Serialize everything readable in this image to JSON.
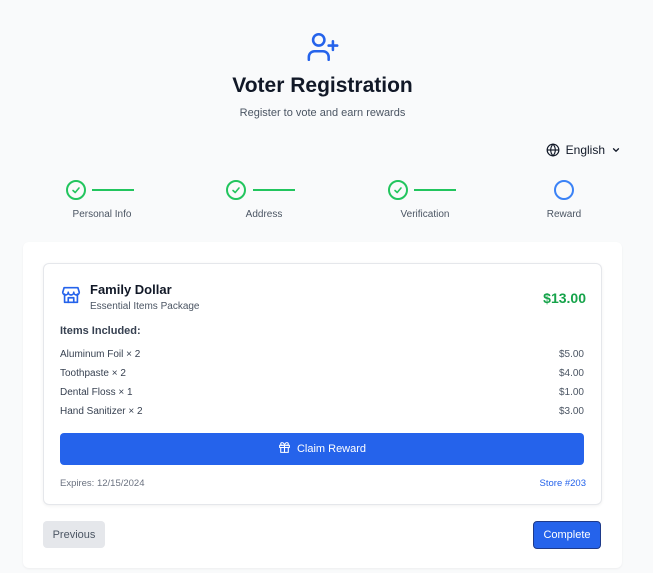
{
  "header": {
    "title": "Voter Registration",
    "subtitle": "Register to vote and earn rewards",
    "logo_icon": "user-plus-icon"
  },
  "language": {
    "selected": "English",
    "icon": "globe-icon"
  },
  "steps": [
    {
      "label": "Personal Info",
      "status": "complete"
    },
    {
      "label": "Address",
      "status": "complete"
    },
    {
      "label": "Verification",
      "status": "complete"
    },
    {
      "label": "Reward",
      "status": "pending"
    }
  ],
  "reward": {
    "store_name": "Family Dollar",
    "package": "Essential Items Package",
    "total": "$13.00",
    "items_heading": "Items Included:",
    "items": [
      {
        "name": "Aluminum Foil × 2",
        "price": "$5.00"
      },
      {
        "name": "Toothpaste × 2",
        "price": "$4.00"
      },
      {
        "name": "Dental Floss × 1",
        "price": "$1.00"
      },
      {
        "name": "Hand Sanitizer × 2",
        "price": "$3.00"
      }
    ],
    "claim_label": "Claim Reward",
    "expires": "Expires: 12/15/2024",
    "store_number": "Store #203"
  },
  "nav": {
    "previous_label": "Previous",
    "complete_label": "Complete"
  },
  "colors": {
    "primary": "#2563eb",
    "success": "#22c55e",
    "total": "#16a34a"
  }
}
